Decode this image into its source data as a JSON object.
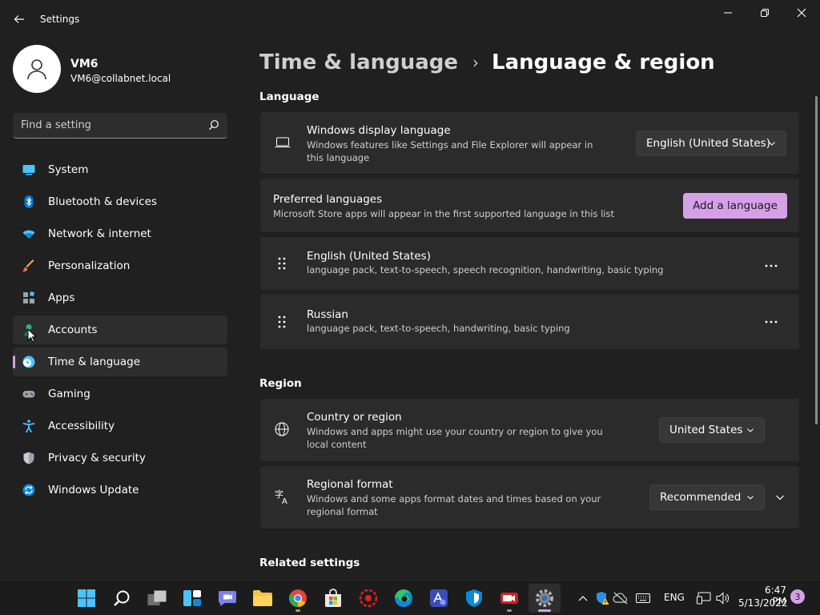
{
  "window": {
    "title": "Settings"
  },
  "profile": {
    "name": "VM6",
    "email": "VM6@collabnet.local"
  },
  "search": {
    "placeholder": "Find a setting"
  },
  "sidebar": {
    "items": [
      {
        "label": "System",
        "icon": "system-icon"
      },
      {
        "label": "Bluetooth & devices",
        "icon": "bluetooth-icon"
      },
      {
        "label": "Network & internet",
        "icon": "wifi-icon"
      },
      {
        "label": "Personalization",
        "icon": "brush-icon"
      },
      {
        "label": "Apps",
        "icon": "apps-icon"
      },
      {
        "label": "Accounts",
        "icon": "accounts-icon"
      },
      {
        "label": "Time & language",
        "icon": "clock-globe-icon"
      },
      {
        "label": "Gaming",
        "icon": "gamepad-icon"
      },
      {
        "label": "Accessibility",
        "icon": "accessibility-icon"
      },
      {
        "label": "Privacy & security",
        "icon": "shield-icon"
      },
      {
        "label": "Windows Update",
        "icon": "update-icon"
      }
    ],
    "active_item": "Time & language",
    "hovered_item": "Accounts"
  },
  "breadcrumb": {
    "parent": "Time & language",
    "separator": "›",
    "current": "Language & region"
  },
  "language_section": {
    "title": "Language",
    "display_language": {
      "title": "Windows display language",
      "description": "Windows features like Settings and File Explorer will appear in this language",
      "value": "English (United States)"
    },
    "preferred": {
      "title": "Preferred languages",
      "description": "Microsoft Store apps will appear in the first supported language in this list",
      "button": "Add a language"
    },
    "languages": [
      {
        "name": "English (United States)",
        "features": "language pack, text-to-speech, speech recognition, handwriting, basic typing"
      },
      {
        "name": "Russian",
        "features": "language pack, text-to-speech, handwriting, basic typing"
      }
    ]
  },
  "region_section": {
    "title": "Region",
    "country": {
      "title": "Country or region",
      "description": "Windows and apps might use your country or region to give you local content",
      "value": "United States"
    },
    "format": {
      "title": "Regional format",
      "description": "Windows and some apps format dates and times based on your regional format",
      "value": "Recommended"
    }
  },
  "related": {
    "title": "Related settings"
  },
  "taskbar": {
    "apps": [
      "start",
      "search",
      "task-view",
      "widgets",
      "chat",
      "file-explorer",
      "chrome",
      "store",
      "app-red",
      "edge",
      "app-blue",
      "defender",
      "camera-app",
      "settings"
    ],
    "language": "ENG",
    "time": "6:47 PM",
    "date": "5/13/2022",
    "notifications": "3"
  },
  "colors": {
    "accent": "#d6a0e8",
    "background": "#202020",
    "card": "#2b2b2b"
  }
}
